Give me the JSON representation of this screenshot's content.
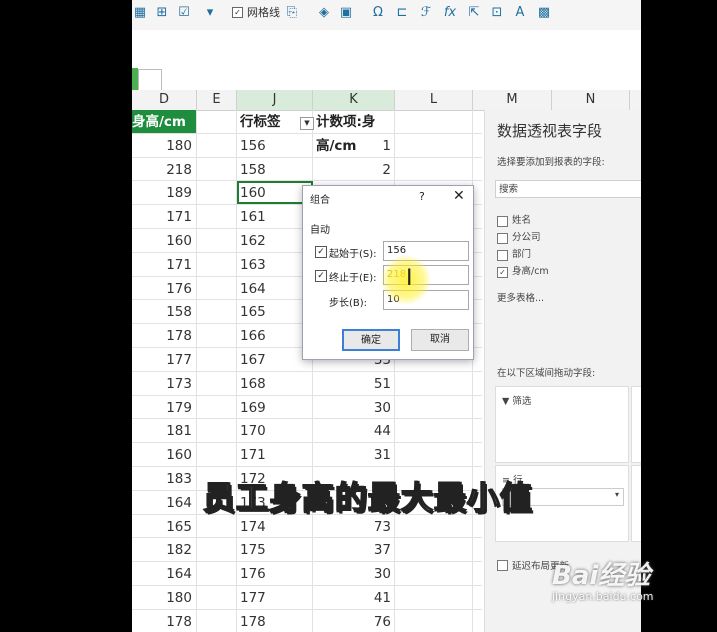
{
  "toolbar": {
    "gridlines_label": "网格线"
  },
  "columns": [
    "D",
    "E",
    "J",
    "K",
    "L",
    "M",
    "N"
  ],
  "sheet": {
    "header": {
      "d": "身高/cm",
      "j": "行标签",
      "k": "计数项:身高/cm"
    },
    "rows": [
      {
        "d": "180",
        "j": "156",
        "k": "1"
      },
      {
        "d": "218",
        "j": "158",
        "k": "2"
      },
      {
        "d": "189",
        "j": "160",
        "k": ""
      },
      {
        "d": "171",
        "j": "161",
        "k": ""
      },
      {
        "d": "160",
        "j": "162",
        "k": ""
      },
      {
        "d": "171",
        "j": "163",
        "k": ""
      },
      {
        "d": "176",
        "j": "164",
        "k": ""
      },
      {
        "d": "158",
        "j": "165",
        "k": ""
      },
      {
        "d": "178",
        "j": "166",
        "k": ""
      },
      {
        "d": "177",
        "j": "167",
        "k": "33"
      },
      {
        "d": "173",
        "j": "168",
        "k": "51"
      },
      {
        "d": "179",
        "j": "169",
        "k": "30"
      },
      {
        "d": "181",
        "j": "170",
        "k": "44"
      },
      {
        "d": "160",
        "j": "171",
        "k": "31"
      },
      {
        "d": "183",
        "j": "172",
        "k": ""
      },
      {
        "d": "164",
        "j": "173",
        "k": ""
      },
      {
        "d": "165",
        "j": "174",
        "k": "73"
      },
      {
        "d": "182",
        "j": "175",
        "k": "37"
      },
      {
        "d": "164",
        "j": "176",
        "k": "30"
      },
      {
        "d": "180",
        "j": "177",
        "k": "41"
      },
      {
        "d": "178",
        "j": "178",
        "k": "76"
      }
    ]
  },
  "dialog": {
    "title": "组合",
    "help": "?",
    "close": "✕",
    "auto_label": "自动",
    "start_label": "起始于(S):",
    "start_value": "156",
    "end_label": "终止于(E):",
    "end_value": "218",
    "step_label": "步长(B):",
    "step_value": "10",
    "ok": "确定",
    "cancel": "取消"
  },
  "pivot": {
    "title": "数据透视表字段",
    "subtitle": "选择要添加到报表的字段:",
    "search_placeholder": "搜索",
    "fields": [
      {
        "label": "姓名",
        "checked": false
      },
      {
        "label": "分公司",
        "checked": false
      },
      {
        "label": "部门",
        "checked": false
      },
      {
        "label": "身高/cm",
        "checked": true
      }
    ],
    "more_tables": "更多表格...",
    "area_hint": "在以下区域间拖动字段:",
    "filter_label": "筛选",
    "rows_label": "行",
    "defer_label": "延迟布局更新"
  },
  "subtitle": "员工身高的最大最小值",
  "watermark": {
    "logo": "Bai经验",
    "url": "jingyan.baidu.com"
  }
}
